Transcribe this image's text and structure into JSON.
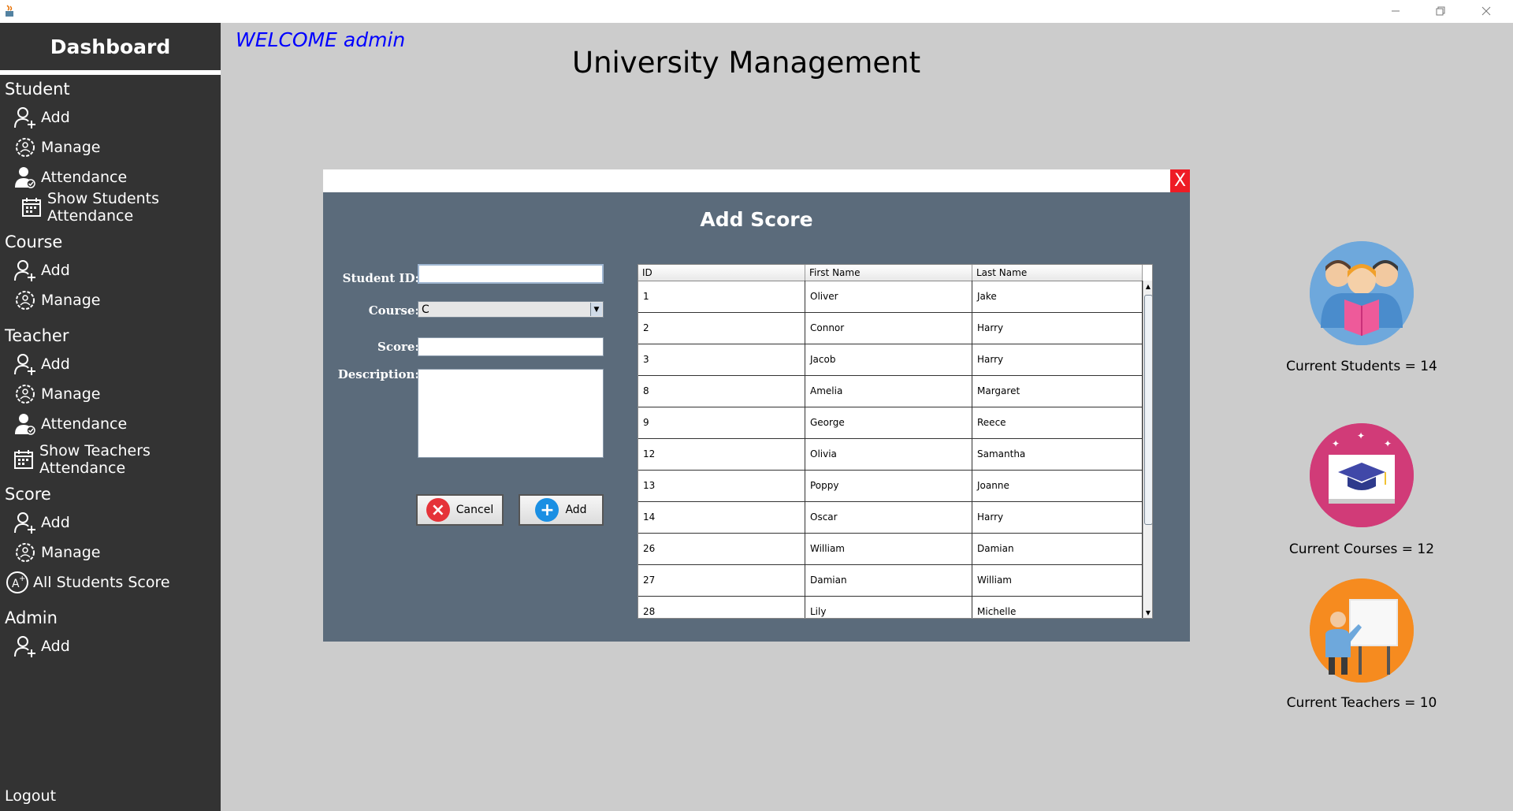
{
  "window": {
    "controls": [
      "minimize-icon",
      "restore-icon",
      "close-icon"
    ]
  },
  "sidebar": {
    "title": "Dashboard",
    "sections": {
      "student": {
        "label": "Student",
        "add": "Add",
        "manage": "Manage",
        "attendance": "Attendance",
        "show_attendance": "Show Students Attendance"
      },
      "course": {
        "label": "Course",
        "add": "Add",
        "manage": "Manage"
      },
      "teacher": {
        "label": "Teacher",
        "add": "Add",
        "manage": "Manage",
        "attendance": "Attendance",
        "show_attendance": "Show Teachers Attendance"
      },
      "score": {
        "label": "Score",
        "add": "Add",
        "manage": "Manage",
        "all_scores": "All Students Score"
      },
      "admin": {
        "label": "Admin",
        "add": "Add"
      }
    },
    "logout": "Logout"
  },
  "header": {
    "welcome": "WELCOME admin",
    "title": "University Management"
  },
  "dialog": {
    "close_label": "X",
    "title": "Add Score",
    "labels": {
      "student_id": "Student ID:",
      "course": "Course:",
      "score": "Score:",
      "description": "Description:"
    },
    "values": {
      "student_id": "",
      "course": "C",
      "score": "",
      "description": ""
    },
    "buttons": {
      "cancel": "Cancel",
      "add": "Add"
    },
    "table": {
      "columns": [
        "ID",
        "First Name",
        "Last Name"
      ],
      "rows": [
        [
          "1",
          "Oliver",
          "Jake"
        ],
        [
          "2",
          "Connor",
          "Harry"
        ],
        [
          "3",
          "Jacob",
          "Harry"
        ],
        [
          "8",
          "Amelia",
          "Margaret"
        ],
        [
          "9",
          "George",
          "Reece"
        ],
        [
          "12",
          "Olivia",
          "Samantha"
        ],
        [
          "13",
          "Poppy",
          "Joanne"
        ],
        [
          "14",
          "Oscar",
          "Harry"
        ],
        [
          "26",
          "William",
          "Damian"
        ],
        [
          "27",
          "Damian",
          "William"
        ],
        [
          "28",
          "Lily",
          "Michelle"
        ]
      ]
    }
  },
  "stats": {
    "students": "Current Students = 14",
    "courses": "Current Courses = 12",
    "teachers": "Current Teachers = 10"
  },
  "colors": {
    "sidebar_bg": "#333333",
    "dialog_bg": "#5b6b7b",
    "close_red": "#ee1c25",
    "welcome_blue": "#0000ff"
  }
}
